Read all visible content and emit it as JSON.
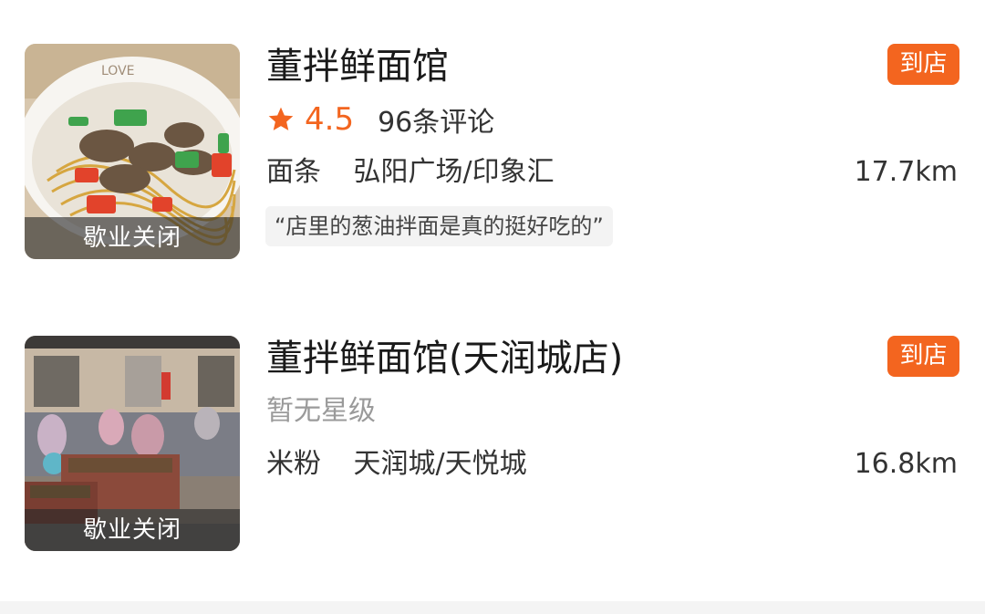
{
  "colors": {
    "accent": "#f3651f",
    "text": "#1a1a1a",
    "muted": "#9a9a9a",
    "quote_bg": "#f3f3f3"
  },
  "listings": [
    {
      "name": "董拌鲜面馆",
      "visit_button": "到店",
      "thumbnail_status": "歇业关闭",
      "thumbnail_icon": "noodle-bowl-photo",
      "rating": "4.5",
      "star_icon": "star-icon",
      "reviews": "96条评论",
      "category": "面条",
      "area": "弘阳广场/印象汇",
      "distance": "17.7km",
      "quote": "“店里的葱油拌面是真的挺好吃的”"
    },
    {
      "name": "董拌鲜面馆(天润城店)",
      "visit_button": "到店",
      "thumbnail_status": "歇业关闭",
      "thumbnail_icon": "storefront-photo",
      "rating_text": "暂无星级",
      "category": "米粉",
      "area": "天润城/天悦城",
      "distance": "16.8km"
    }
  ]
}
